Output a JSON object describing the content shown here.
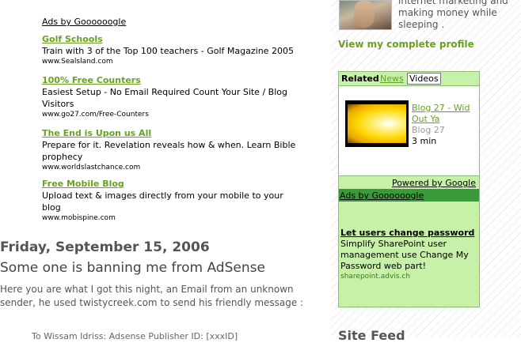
{
  "ads": {
    "header": "Ads by Goooooogle",
    "items": [
      {
        "title": "Golf Schools",
        "text": "Train with 3 of the Top 100 teachers - Golf Magazine 2005",
        "url": "www.Sealsland.com"
      },
      {
        "title": "100% Free Counters",
        "text": "Easiest Setup - No Email Required Count Your Site / Blog Visitors",
        "url": "www.go27.com/Free-Counters"
      },
      {
        "title": "The End is Upon us All",
        "text": "Prepare for it. Revelation reveals how & when. Learn Bible prophecy",
        "url": "www.worldslastchance.com"
      },
      {
        "title": "Free Mobile Blog",
        "text": "Upload text & images directly from your mobile to your blog",
        "url": "www.mobispine.com"
      }
    ]
  },
  "post": {
    "date": "Friday, September 15, 2006",
    "title": "Some one is banning me from AdSense",
    "body": "Here you are what I got this night, an Email from an unknown sender, he used twistycreek.com to send his friendly message :",
    "fade_line": "To Wissam Idriss: Adsense Publisher ID: [xxxID]"
  },
  "sidebar": {
    "about": "internet marketing and making money while sleeping .",
    "profile_link": "View my complete profile",
    "videobar": {
      "tabs": [
        "Related",
        "News",
        "Videos"
      ],
      "video": {
        "title": "Blog 27 - Wid Out Ya",
        "channel": "Blog 27",
        "duration": "3 min"
      },
      "powered_by": "Powered by Google",
      "ads_header": "Ads by Goooooogle",
      "ad": {
        "title": "Let users change password",
        "text": "Simplify SharePoint user management use Change My Password web part!",
        "url": "sharepoint.advis.ch"
      }
    },
    "site_feed": "Site Feed"
  },
  "colors": {
    "link_green": "#6aa121",
    "videobar_bg": "#c7f0a8",
    "ads_bar": "#3a9a3a"
  }
}
